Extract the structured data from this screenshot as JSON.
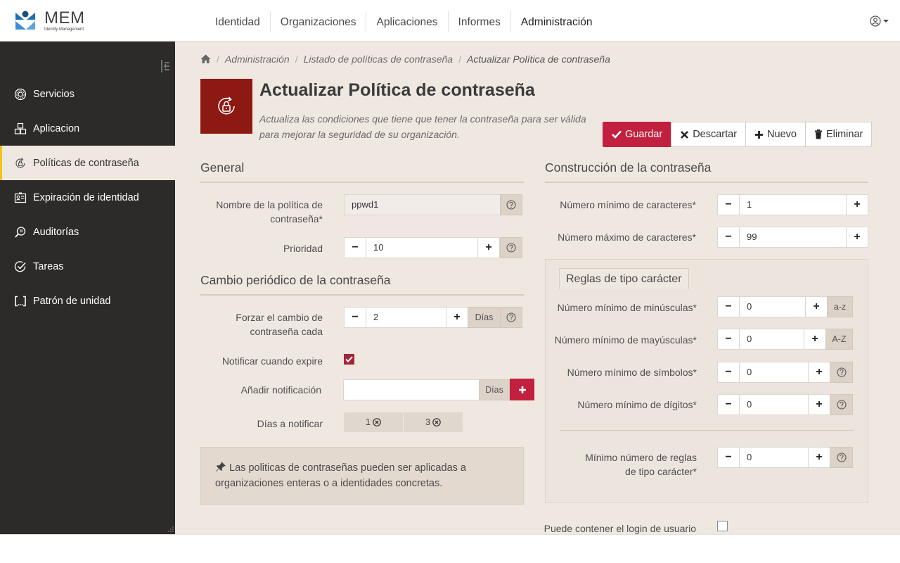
{
  "app": {
    "logo_title": "MEM",
    "logo_subtitle": "Identity Management"
  },
  "topnav": [
    {
      "label": "Identidad"
    },
    {
      "label": "Organizaciones"
    },
    {
      "label": "Aplicaciones"
    },
    {
      "label": "Informes"
    },
    {
      "label": "Administración",
      "active": true
    }
  ],
  "sidebar": {
    "items": [
      {
        "label": "Servicios",
        "icon": "services-icon"
      },
      {
        "label": "Aplicacion",
        "icon": "cubes-icon"
      },
      {
        "label": "Políticas de contraseña",
        "icon": "lock-refresh-icon",
        "active": true
      },
      {
        "label": "Expiración de identidad",
        "icon": "id-card-icon"
      },
      {
        "label": "Auditorías",
        "icon": "search-doc-icon"
      },
      {
        "label": "Tareas",
        "icon": "check-circle-icon"
      },
      {
        "label": "Patrón de unidad",
        "icon": "brackets-icon"
      }
    ]
  },
  "breadcrumb": {
    "items": [
      "Administración",
      "Listado de políticas de contraseña"
    ],
    "current": "Actualizar Política de contraseña"
  },
  "page": {
    "title": "Actualizar Política de contraseña",
    "description": "Actualiza las condiciones que tiene que tener la contraseña para ser válida para mejorar la seguridad de su organización."
  },
  "actions": {
    "save": "Guardar",
    "discard": "Descartar",
    "new": "Nuevo",
    "delete": "Eliminar"
  },
  "general": {
    "title": "General",
    "name_label": "Nombre de la política de contraseña*",
    "name_value": "ppwd1",
    "priority_label": "Prioridad",
    "priority_value": "10"
  },
  "periodic": {
    "title": "Cambio periódico de la contraseña",
    "force_label": "Forzar el cambio de contraseña cada",
    "force_value": "2",
    "force_unit": "Días",
    "notify_label": "Notificar cuando expire",
    "notify_checked": true,
    "add_notification_label": "Añadir notificación",
    "add_notification_value": "",
    "add_notification_unit": "Días",
    "days_label": "Días a notificar",
    "days": [
      "1",
      "3"
    ]
  },
  "info": {
    "text": "Las politicas de contraseñas pueden ser aplicadas a organizaciones enteras o a identidades concretas."
  },
  "construction": {
    "title": "Construcción de la contraseña",
    "min_chars_label": "Número mínimo de caracteres*",
    "min_chars_value": "1",
    "max_chars_label": "Número máximo de caracteres*",
    "max_chars_value": "99"
  },
  "rules": {
    "tab": "Reglas de tipo carácter",
    "lower_label": "Número mínimo de minúsculas*",
    "lower_value": "0",
    "lower_addon": "a-z",
    "upper_label": "Número mínimo de mayúsculas*",
    "upper_value": "0",
    "upper_addon": "A-Z",
    "symbols_label": "Número mínimo de símbolos*",
    "symbols_value": "0",
    "digits_label": "Número mínimo de dígitos*",
    "digits_value": "0",
    "min_rules_label": "Mínimo número de reglas de tipo carácter*",
    "min_rules_value": "0"
  },
  "login": {
    "label": "Puede contener el login de usuario",
    "checked": false
  },
  "colors": {
    "primary": "#c1213e",
    "sidebar_bg": "#2d2b2a",
    "page_bg": "#efe8e1",
    "accent_active": "#f0c419"
  }
}
